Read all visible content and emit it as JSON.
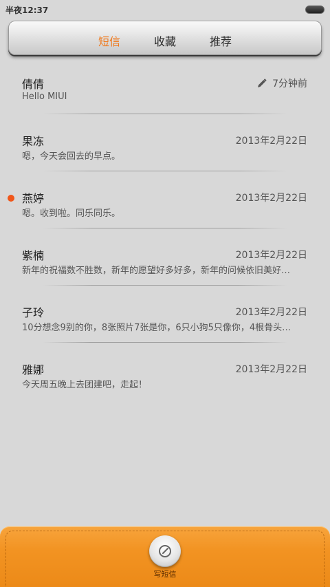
{
  "status_bar": {
    "time": "半夜12:37"
  },
  "tabs": [
    {
      "label": "短信",
      "active": true
    },
    {
      "label": "收藏",
      "active": false
    },
    {
      "label": "推荐",
      "active": false
    }
  ],
  "conversations": [
    {
      "name": "倩倩",
      "time": "7分钟前",
      "snippet": "Hello MIUI",
      "draft": true,
      "unread": false
    },
    {
      "name": "果冻",
      "time": "2013年2月22日",
      "snippet": "嗯，今天会回去的早点。",
      "draft": false,
      "unread": false
    },
    {
      "name": "燕婷",
      "time": "2013年2月22日",
      "snippet": "嗯。收到啦。同乐同乐。",
      "draft": false,
      "unread": true
    },
    {
      "name": "紫楠",
      "time": "2013年2月22日",
      "snippet": "新年的祝福数不胜数，新年的愿望好多好多，新年的问候依旧美好…",
      "draft": false,
      "unread": false
    },
    {
      "name": "子玲",
      "time": "2013年2月22日",
      "snippet": "10分想念9别的你，8张照片7张是你，6只小狗5只像你，4根骨头…",
      "draft": false,
      "unread": false
    },
    {
      "name": "雅娜",
      "time": "2013年2月22日",
      "snippet": "今天周五晚上去团建吧，走起！",
      "draft": false,
      "unread": false
    }
  ],
  "compose": {
    "label": "写短信",
    "icon": "compose-icon"
  },
  "colors": {
    "accent": "#ef7a1f",
    "unread": "#f0561a",
    "bottom_bar": "#f29322"
  }
}
